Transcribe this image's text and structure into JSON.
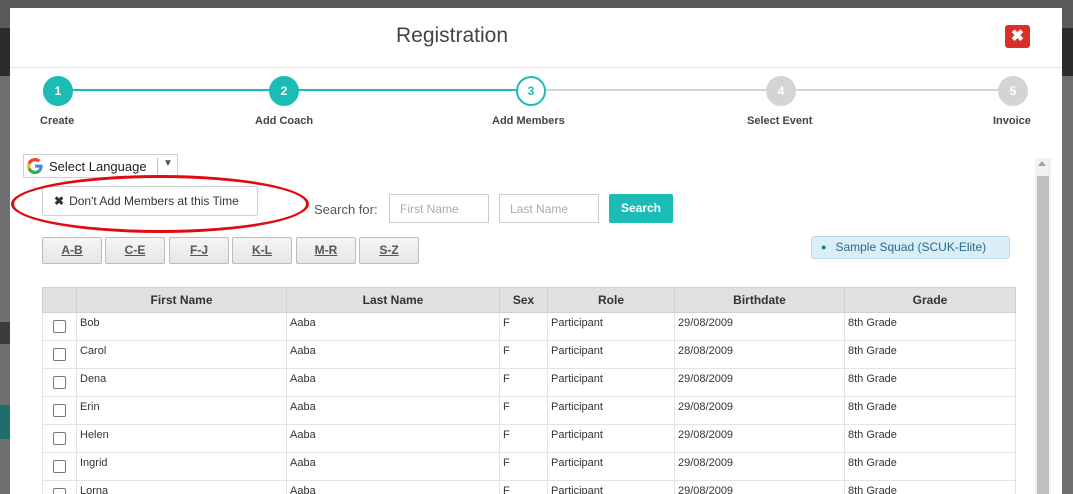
{
  "modal": {
    "title": "Registration",
    "close_label": "✖"
  },
  "steps": [
    {
      "number": "1",
      "label": "Create",
      "state": "done"
    },
    {
      "number": "2",
      "label": "Add Coach",
      "state": "done"
    },
    {
      "number": "3",
      "label": "Add Members",
      "state": "current"
    },
    {
      "number": "4",
      "label": "Select Event",
      "state": "todo"
    },
    {
      "number": "5",
      "label": "Invoice",
      "state": "todo"
    }
  ],
  "language": {
    "label": "Select Language",
    "arrow": "▼"
  },
  "dont_add": {
    "icon": "✖",
    "label": "Don't Add Members at this Time"
  },
  "search": {
    "label": "Search for:",
    "first_placeholder": "First Name",
    "last_placeholder": "Last Name",
    "button": "Search"
  },
  "alpha_filters": [
    "A-B",
    "C-E",
    "F-J",
    "K-L",
    "M-R",
    "S-Z"
  ],
  "squad": {
    "dot": "●",
    "label": "Sample Squad (SCUK-Elite)"
  },
  "table": {
    "headers": [
      "",
      "First Name",
      "Last Name",
      "Sex",
      "Role",
      "Birthdate",
      "Grade"
    ],
    "rows": [
      [
        "Bob",
        "Aaba",
        "F",
        "Participant",
        "29/08/2009",
        "8th Grade"
      ],
      [
        "Carol",
        "Aaba",
        "F",
        "Participant",
        "28/08/2009",
        "8th Grade"
      ],
      [
        "Dena",
        "Aaba",
        "F",
        "Participant",
        "29/08/2009",
        "8th Grade"
      ],
      [
        "Erin",
        "Aaba",
        "F",
        "Participant",
        "29/08/2009",
        "8th Grade"
      ],
      [
        "Helen",
        "Aaba",
        "F",
        "Participant",
        "29/08/2009",
        "8th Grade"
      ],
      [
        "Ingrid",
        "Aaba",
        "F",
        "Participant",
        "29/08/2009",
        "8th Grade"
      ],
      [
        "Lorna",
        "Aaba",
        "F",
        "Participant",
        "29/08/2009",
        "8th Grade"
      ]
    ]
  },
  "colors": {
    "accent": "#1bbcb6",
    "danger": "#d9302a",
    "highlight": "#e00b12"
  }
}
